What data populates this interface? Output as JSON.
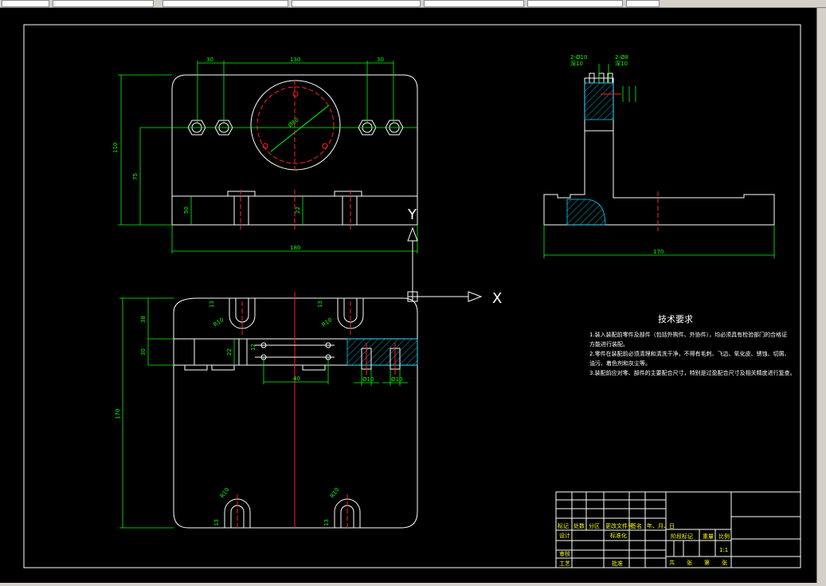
{
  "topbar": {
    "tabs": [
      "",
      "",
      "",
      "",
      "",
      "",
      ""
    ]
  },
  "front_view": {
    "dim_top_left": "30",
    "dim_top_center": "130",
    "dim_top_right": "30",
    "dim_height_total": "110",
    "dim_height_mid": "75",
    "dim_height_small_left": "50",
    "dim_height_small_mid": "22",
    "dim_width": "180",
    "dim_diameter": "Ø80"
  },
  "axis": {
    "x_label": "X",
    "y_label": "Y"
  },
  "side_view": {
    "dim_width": "170",
    "note_left": "2-Ø10",
    "note_left_2": "深10",
    "note_right": "2-Ø8",
    "note_right_2": "深10"
  },
  "top_view": {
    "dim_height": "170",
    "dim_a": "38",
    "dim_b": "30",
    "dim_c": "22",
    "dim_d": "40",
    "dim_e": "12",
    "dim_f": "13",
    "dim_r_left": "R10",
    "dim_r_right": "R10",
    "dim_hole_a": "Ø10",
    "dim_hole_b": "Ø10"
  },
  "tech_req": {
    "title": "技术要求",
    "lines": [
      "1.装入装配前零件及部件（包括外购件、外协件），均必须具有检验部门的合格证",
      "  方能进行装配。",
      "2.零件在装配前必须清理和清洗干净，不得有毛刺、飞边、氧化皮、锈蚀、切屑、",
      "  油污、着色剂和灰尘等。",
      "3.装配前应对零、部件的主要配合尺寸，特别是过盈配合尺寸及相关精度进行复查。"
    ]
  },
  "title_block": {
    "row_labels": [
      "标记",
      "处数",
      "分区",
      "更改文件号",
      "签名",
      "年、月、日"
    ],
    "design": "设计",
    "standard": "标准化",
    "review": "审核",
    "process": "工艺",
    "approve": "批准",
    "stage_mark": "阶段标记",
    "weight": "重量",
    "scale": "比例",
    "scale_value": "1:1",
    "sheets": [
      "共",
      "张",
      "第",
      "张"
    ]
  }
}
